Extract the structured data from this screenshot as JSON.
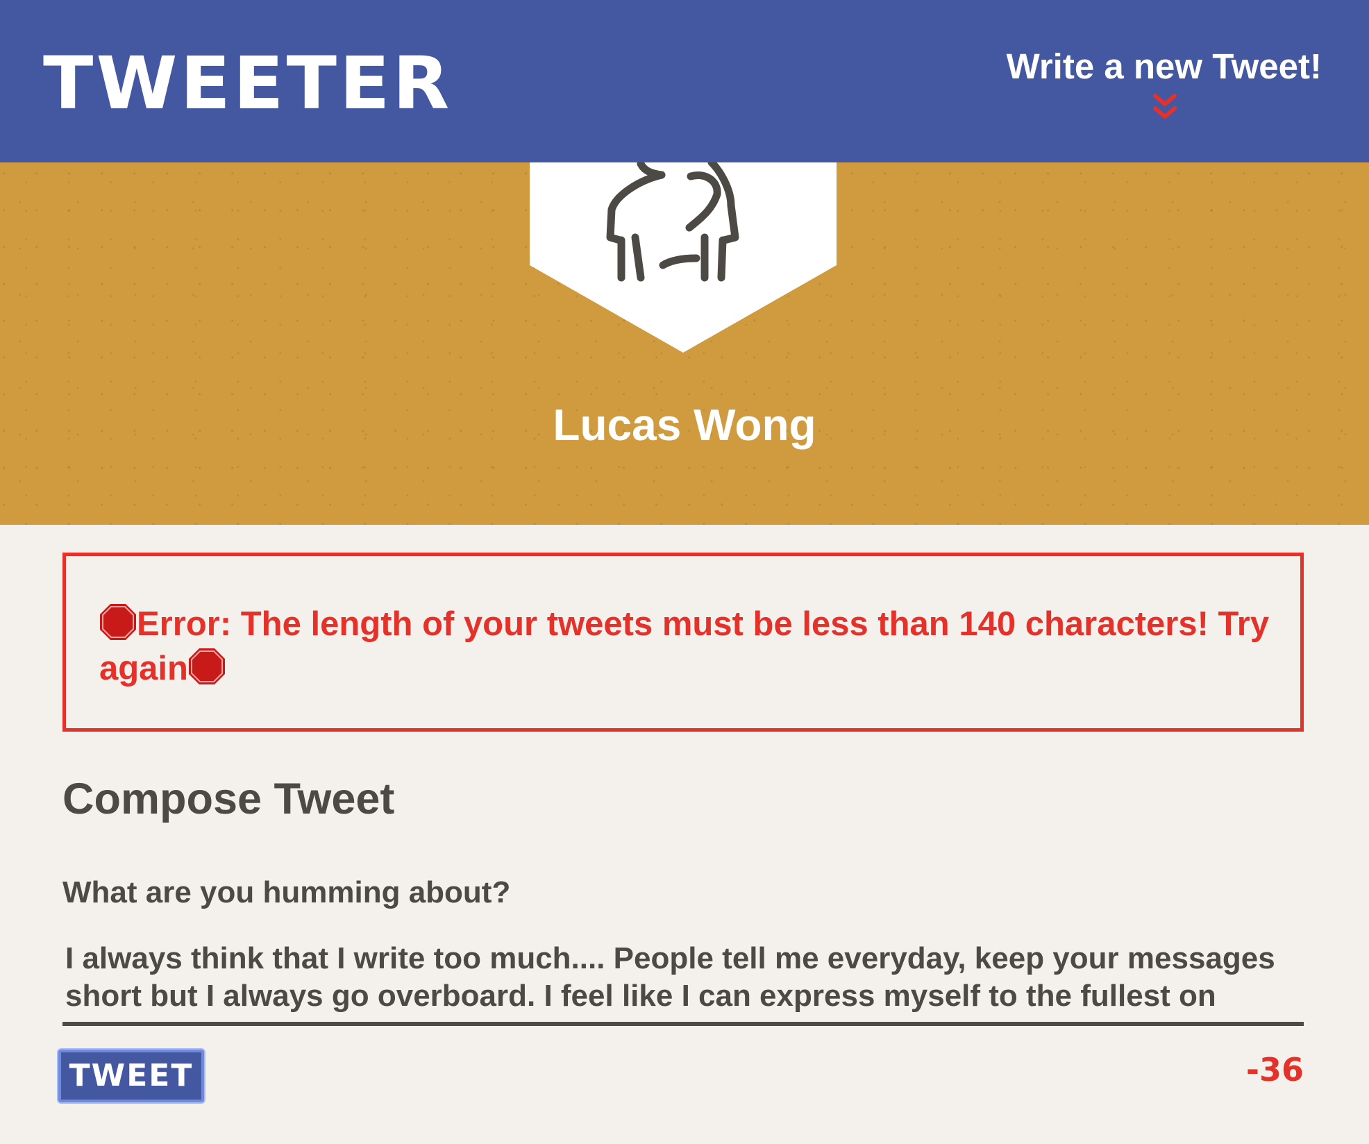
{
  "nav": {
    "logo": "TWEETER",
    "write_link": "Write a new Tweet!",
    "chevron_icon": "double-chevron-down-icon",
    "background_color": "#4358a0",
    "chevron_color": "#e4322b"
  },
  "profile": {
    "name": "Lucas Wong",
    "avatar_icon": "person-avatar-icon",
    "background_color": "#cf9b3e"
  },
  "error": {
    "emoji_icon": "stop-sign-icon",
    "message": "Error: The length of your tweets must be less than 140 characters! Try again",
    "color": "#e4322b"
  },
  "compose": {
    "title": "Compose Tweet",
    "label": "What are you humming about?",
    "text": "I always think that I write too much.... People tell me everyday, keep your messages short but I always go overboard. I feel like I can express myself to the fullest on tweeter",
    "button_label": "TWEET",
    "counter": "-36"
  }
}
